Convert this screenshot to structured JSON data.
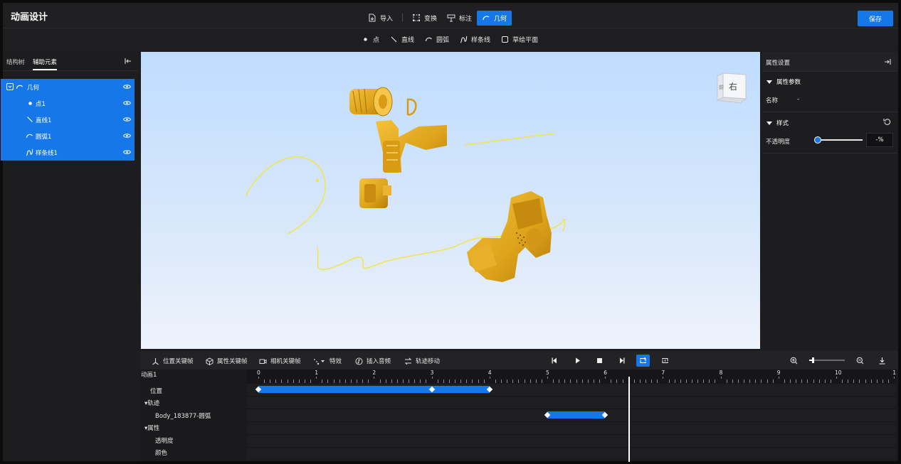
{
  "app": {
    "title": "动画设计",
    "save_label": "保存"
  },
  "top_toolbar": {
    "import": "导入",
    "transform": "变换",
    "annotate": "标注",
    "geometry": "几何"
  },
  "sub_toolbar": {
    "point": "点",
    "line": "直线",
    "arc": "圆弧",
    "spline": "样条线",
    "sketch_plane": "草绘平面"
  },
  "left_panel": {
    "tabs": [
      "结构树",
      "辅助元素"
    ],
    "active_tab": "辅助元素",
    "tree": [
      {
        "label": "几何",
        "icon": "arc-icon"
      },
      {
        "label": "点1",
        "icon": "point-icon"
      },
      {
        "label": "直线1",
        "icon": "line-icon"
      },
      {
        "label": "圆弧1",
        "icon": "arc-icon"
      },
      {
        "label": "样条线1",
        "icon": "spline-icon"
      }
    ]
  },
  "viewport": {
    "view_cube_face": "右"
  },
  "right_panel": {
    "title": "属性设置",
    "params_section": "属性参数",
    "name_label": "名称",
    "name_value": "-",
    "style_section": "样式",
    "opacity_label": "不透明度",
    "opacity_value": "-%",
    "opacity_slider_level": 0
  },
  "timeline": {
    "toolbar": {
      "position_keyframe": "位置关键帧",
      "property_keyframe": "属性关键帧",
      "camera_keyframe": "相机关键帧",
      "effects": "特效",
      "insert_audio": "插入音频",
      "track_move": "轨迹移动"
    },
    "animation_name": "动画1",
    "rows": [
      "位置",
      "▾轨迹",
      "Body_183877-圆弧",
      "▾属性",
      "透明度",
      "颜色"
    ],
    "ruler_labels": [
      "0",
      "1",
      "2",
      "3",
      "4",
      "5",
      "6",
      "7",
      "8",
      "9",
      "10",
      "1"
    ],
    "playhead_time": 6.4,
    "tracks": [
      {
        "row": "位置",
        "start": 0,
        "end": 4,
        "keyframes": [
          0,
          3,
          4
        ]
      },
      {
        "row": "Body_183877-圆弧",
        "start": 5,
        "end": 6,
        "keyframes": [
          5,
          6
        ]
      }
    ],
    "zoom_level": 0.1
  },
  "colors": {
    "accent": "#1677e8",
    "panel": "#1d1d1f",
    "part_gold": "#e3a91f",
    "curve_yellow": "#f2e54a"
  }
}
